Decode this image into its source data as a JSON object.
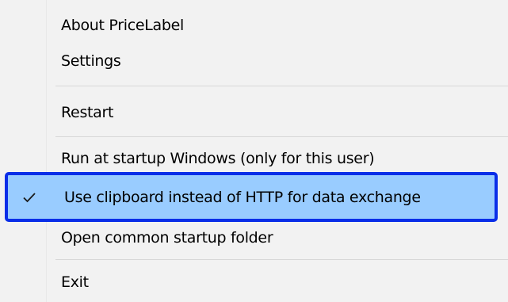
{
  "context_menu": {
    "items": [
      {
        "label": "About PriceLabel"
      },
      {
        "label": "Settings"
      },
      {
        "label": "Restart"
      },
      {
        "label": "Run at startup Windows (only for this user)"
      },
      {
        "label": "Use clipboard instead of HTTP for data exchange",
        "checked": true,
        "highlighted": true
      },
      {
        "label": "Open common startup folder"
      },
      {
        "label": "Exit"
      }
    ],
    "check_icon": "checkmark-icon",
    "highlight_fill": "#99ccff",
    "highlight_border": "#0a2ee8"
  }
}
